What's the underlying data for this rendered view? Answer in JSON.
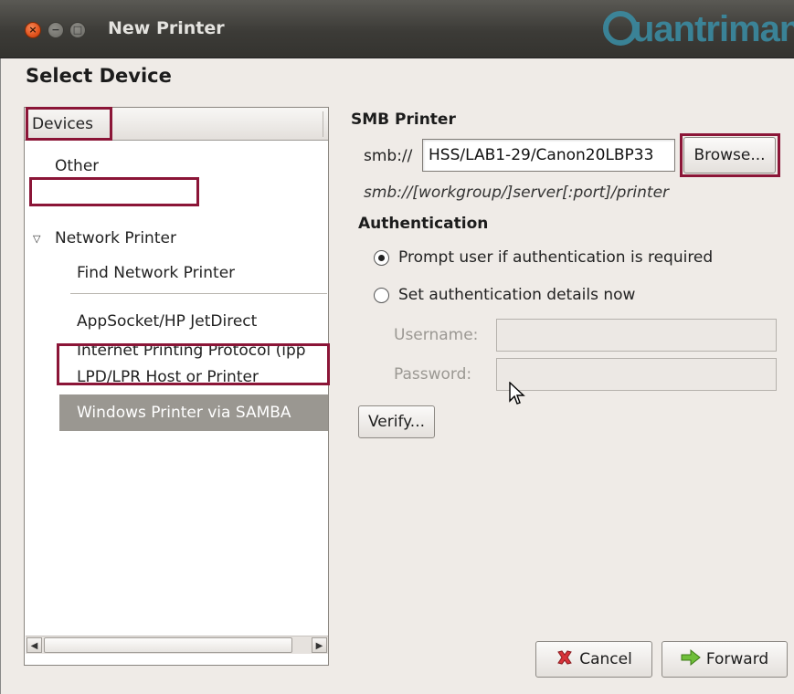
{
  "window": {
    "title": "New Printer",
    "watermark": "Quantrimang"
  },
  "page": {
    "heading": "Select Device"
  },
  "devices": {
    "header": "Devices",
    "items": [
      {
        "label": "Other"
      },
      {
        "label": "Network Printer",
        "expanded": true
      },
      {
        "label": "Find Network Printer"
      },
      {
        "label": "AppSocket/HP JetDirect"
      },
      {
        "label": "Internet Printing Protocol (ipp"
      },
      {
        "label": "LPD/LPR Host or Printer"
      },
      {
        "label": "Windows Printer via SAMBA",
        "selected": true
      }
    ]
  },
  "smb": {
    "section_title": "SMB Printer",
    "prefix": "smb://",
    "value": "HSS/LAB1-29/Canon20LBP33",
    "browse_label": "Browse...",
    "hint": "smb://[workgroup/]server[:port]/printer"
  },
  "auth": {
    "section_title": "Authentication",
    "options": [
      {
        "label": "Prompt user if authentication is required",
        "checked": true
      },
      {
        "label": "Set authentication details now",
        "checked": false
      }
    ],
    "username_label": "Username:",
    "password_label": "Password:",
    "verify_label": "Verify..."
  },
  "buttons": {
    "cancel_label": "Cancel",
    "forward_label": "Forward"
  },
  "colors": {
    "highlight": "#8b1537",
    "selection": "#9a9791",
    "dialog_bg": "#efebe7",
    "titlebar": "#3c3b37",
    "close_button": "#e1521c"
  },
  "icons": {
    "close": "close-icon",
    "minimize": "minimize-icon",
    "maximize": "maximize-icon",
    "expander": "triangle-down-icon",
    "cancel": "cancel-x-icon",
    "forward": "arrow-right-icon",
    "cursor": "mouse-pointer-icon"
  }
}
